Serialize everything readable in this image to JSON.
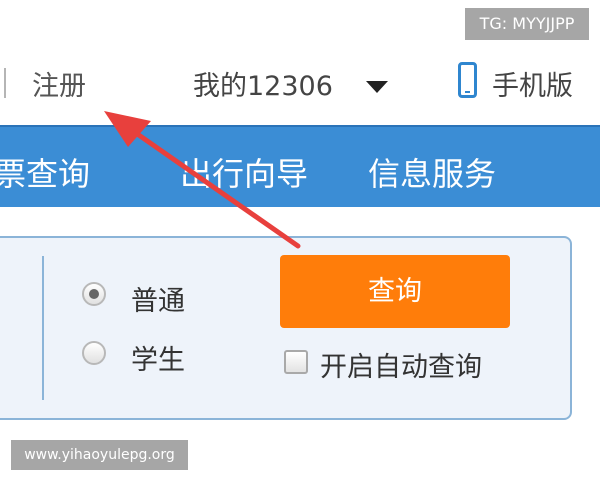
{
  "topbar": {
    "register_label": "注册",
    "my12306_label": "我的12306",
    "mobile_label": "手机版"
  },
  "nav": {
    "items": [
      {
        "label": "票查询"
      },
      {
        "label": "出行向导"
      },
      {
        "label": "信息服务"
      }
    ]
  },
  "query": {
    "ticket_types": [
      {
        "label": "普通",
        "selected": true
      },
      {
        "label": "学生",
        "selected": false
      }
    ],
    "query_button_label": "查询",
    "auto_query_label": "开启自动查询",
    "auto_query_checked": false
  },
  "watermarks": {
    "telegram": "TG: MYYJJPP",
    "website": "www.yihaoyulepg.org"
  },
  "colors": {
    "nav_blue": "#3b8dd5",
    "query_orange": "#ff7d0a",
    "annotation_red": "#e8403d",
    "phone_icon_blue": "#2f86cf"
  }
}
